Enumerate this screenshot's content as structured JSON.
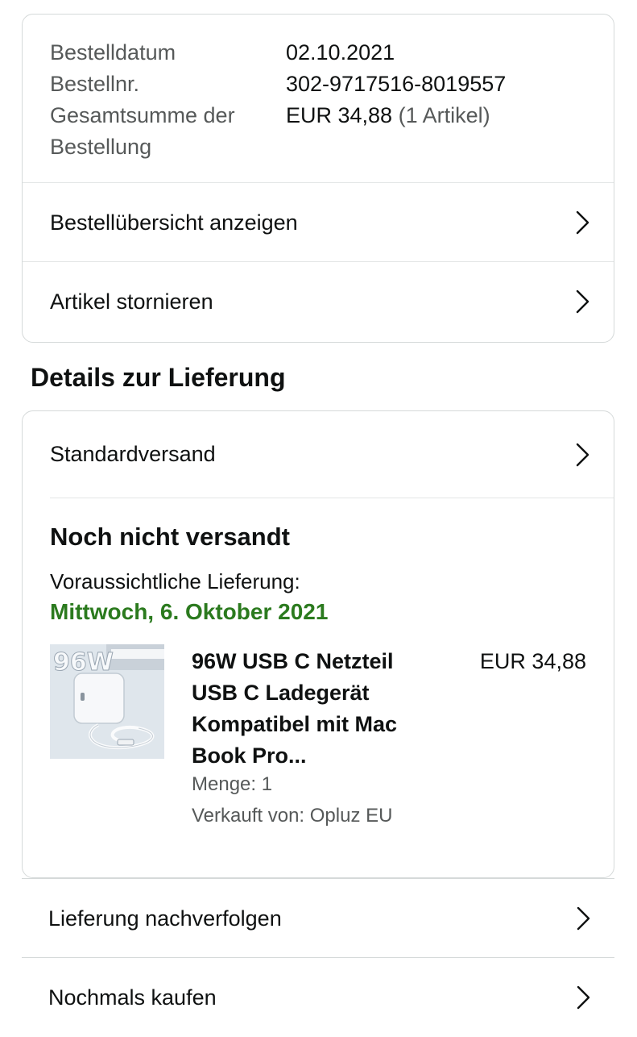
{
  "order_summary": {
    "rows": [
      {
        "label": "Bestelldatum",
        "value": "02.10.2021"
      },
      {
        "label": "Bestellnr.",
        "value": "302-9717516-8019557"
      },
      {
        "label": "Gesamtsumme der Bestellung",
        "value": "EUR 34,88",
        "value_muted": "(1 Artikel)"
      }
    ],
    "view_overview": "Bestellübersicht anzeigen",
    "cancel_items": "Artikel stornieren"
  },
  "delivery": {
    "heading": "Details zur Lieferung",
    "shipping_method": "Standardversand",
    "status": "Noch nicht versandt",
    "expected_label": "Voraussichtliche Lieferung:",
    "expected_date": "Mittwoch, 6. Oktober 2021",
    "product": {
      "image_text": "96W",
      "title": "96W USB C Netzteil USB C Ladegerät Kompatibel mit Mac Book Pro...",
      "price": "EUR 34,88",
      "quantity": "Menge: 1",
      "seller": "Verkauft von: Opluz EU"
    }
  },
  "actions": {
    "track": "Lieferung nachverfolgen",
    "buy_again": "Nochmals kaufen"
  },
  "colors": {
    "delivery_date": "#2b7a1e",
    "muted_text": "#565959",
    "border": "#d5d9d9"
  }
}
